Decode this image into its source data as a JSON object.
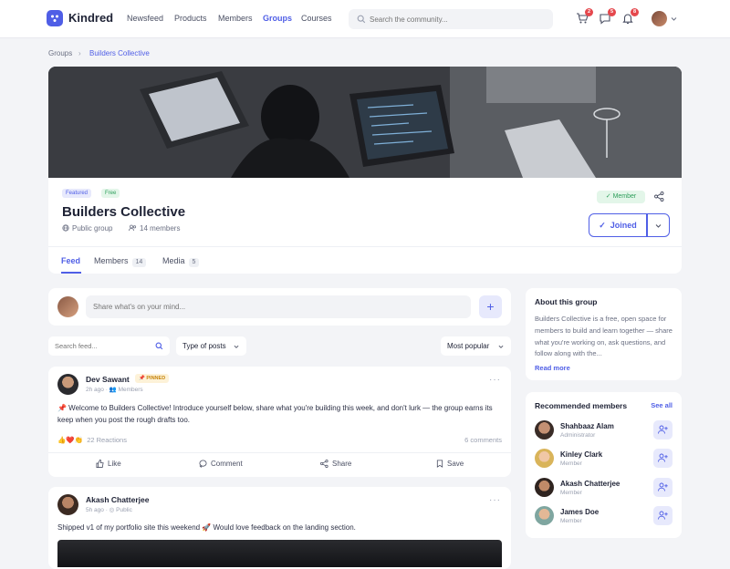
{
  "app": {
    "name": "Kindred"
  },
  "nav": {
    "items": [
      "Newsfeed",
      "Products",
      "Members",
      "Groups",
      "Courses"
    ],
    "active": "Groups"
  },
  "search": {
    "placeholder": "Search the community..."
  },
  "notifications": {
    "cart": "2",
    "messages": "5",
    "bell": "8"
  },
  "breadcrumb": {
    "parent": "Groups",
    "current": "Builders Collective"
  },
  "group": {
    "tags": [
      "Featured",
      "Free"
    ],
    "name": "Builders Collective",
    "privacy": "Public group",
    "members": "14 members",
    "status": "Member",
    "join_label": "Joined"
  },
  "tabs": [
    {
      "label": "Feed",
      "count": ""
    },
    {
      "label": "Members",
      "count": "14"
    },
    {
      "label": "Media",
      "count": "5"
    }
  ],
  "composer": {
    "placeholder": "Share what's on your mind..."
  },
  "filters": {
    "search_placeholder": "Search feed...",
    "type_label": "Type of posts",
    "sort_label": "Most popular"
  },
  "posts": [
    {
      "author": "Dev Sawant",
      "badge": "PINNED",
      "time": "2h ago",
      "audience": "Members",
      "text": "📌 Welcome to Builders Collective! Introduce yourself below, share what you're building this week, and don't lurk — the group earns its keep when you post the rough drafts too.",
      "reactions": "22 Reactions",
      "comments": "6 comments",
      "actions": [
        "Like",
        "Comment",
        "Share",
        "Save"
      ]
    },
    {
      "author": "Akash Chatterjee",
      "time": "5h ago",
      "audience": "Public",
      "text": "Shipped v1 of my portfolio site this weekend 🚀 Would love feedback on the landing section."
    }
  ],
  "about": {
    "title": "About this group",
    "text": "Builders Collective is a free, open space for members to build and learn together — share what you're working on, ask questions, and follow along with the...",
    "read_more": "Read more"
  },
  "recommended": {
    "title": "Recommended members",
    "see_all": "See all",
    "members": [
      {
        "name": "Shahbaaz Alam",
        "role": "Administrator"
      },
      {
        "name": "Kinley Clark",
        "role": "Member"
      },
      {
        "name": "Akash Chatterjee",
        "role": "Member"
      },
      {
        "name": "James Doe",
        "role": "Member"
      }
    ]
  },
  "colors": {
    "accent": "#4f5ee6",
    "success": "#2e9e5b",
    "danger": "#e5484d"
  }
}
